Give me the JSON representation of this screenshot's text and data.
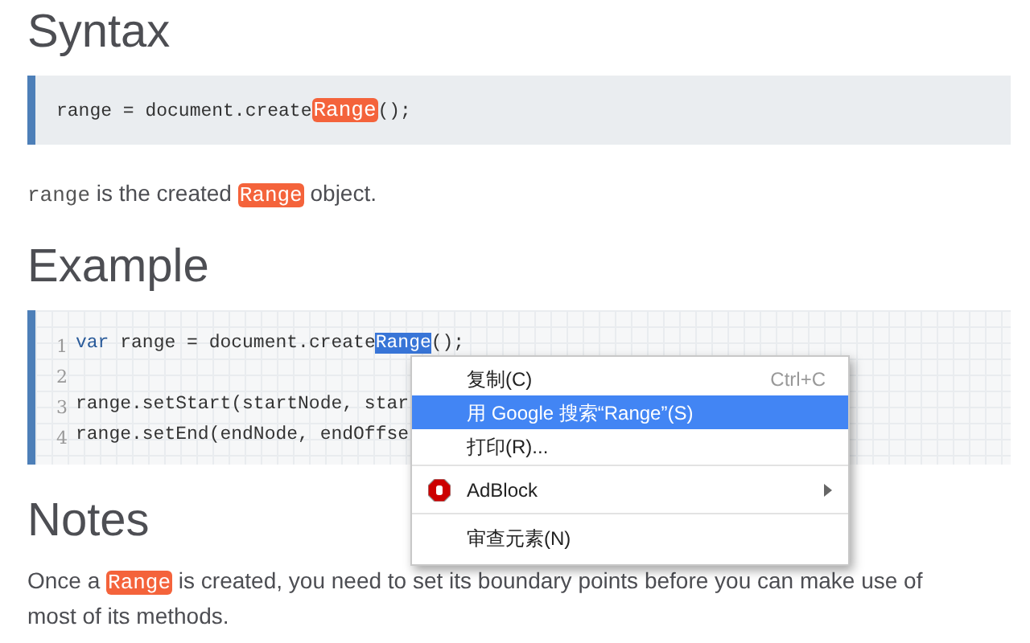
{
  "sections": [
    {
      "heading": "Syntax",
      "code": {
        "kind": "plain",
        "lines": [
          {
            "segments": [
              {
                "text": "range = document.create",
                "kind": "plain"
              },
              {
                "text": "Range",
                "kind": "highlight"
              },
              {
                "text": "();",
                "kind": "plain"
              }
            ]
          }
        ]
      },
      "paragraph": [
        {
          "text": "range",
          "kind": "code"
        },
        {
          "text": " is the created ",
          "kind": "plain"
        },
        {
          "text": "Range",
          "kind": "highlight"
        },
        {
          "text": " object.",
          "kind": "plain"
        }
      ]
    },
    {
      "heading": "Example",
      "code": {
        "kind": "editor",
        "lines": [
          {
            "number": "1",
            "segments": [
              {
                "text": "var",
                "kind": "keyword"
              },
              {
                "text": " range = document.create",
                "kind": "plain"
              },
              {
                "text": "Range",
                "kind": "selected"
              },
              {
                "text": "();",
                "kind": "plain"
              }
            ]
          },
          {
            "number": "2"
          },
          {
            "number": "3",
            "segments": [
              {
                "text": "range.setStart(startNode, star",
                "kind": "plain"
              }
            ]
          },
          {
            "number": "4",
            "segments": [
              {
                "text": "range.setEnd(endNode, endOffse",
                "kind": "plain"
              }
            ]
          }
        ]
      }
    },
    {
      "heading": "Notes",
      "paragraph": [
        {
          "text": "Once a ",
          "kind": "plain"
        },
        {
          "text": "Range",
          "kind": "highlight"
        },
        {
          "text": " is created, you need to set its boundary points before you can make use of most of its methods.",
          "kind": "plain"
        }
      ]
    }
  ],
  "context_menu": {
    "groups": [
      [
        {
          "label": "复制(C)",
          "shortcut": "Ctrl+C",
          "selected": false
        },
        {
          "label": "用 Google 搜索“Range”(S)",
          "selected": true
        },
        {
          "label": "打印(R)...",
          "selected": false
        }
      ],
      [
        {
          "label": "AdBlock",
          "selected": false,
          "submenu": true,
          "icon": true
        }
      ],
      [
        {
          "label": "审查元素(N)",
          "selected": false
        }
      ]
    ]
  }
}
